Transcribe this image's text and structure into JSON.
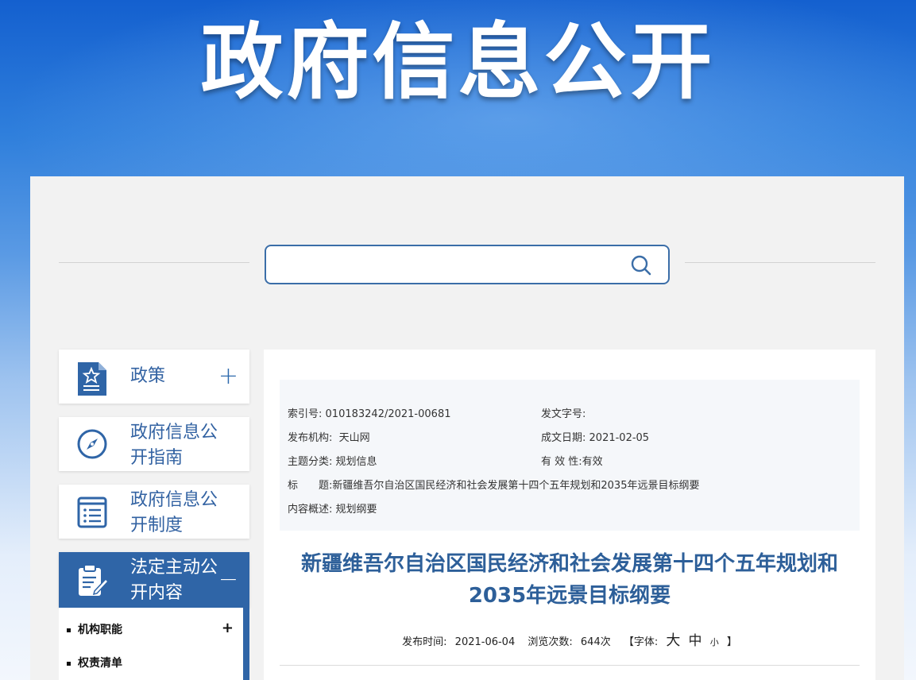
{
  "banner": {
    "title": "政府信息公开"
  },
  "search": {
    "value": "",
    "placeholder": ""
  },
  "sidebar": {
    "items": [
      {
        "label": "政策",
        "toggle": "+",
        "icon": "policy-document-icon"
      },
      {
        "label": "政府信息公开指南",
        "icon": "compass-icon"
      },
      {
        "label": "政府信息公开制度",
        "icon": "list-document-icon"
      },
      {
        "label": "法定主动公开内容",
        "toggle": "−",
        "icon": "clipboard-pen-icon"
      }
    ],
    "subitems": [
      {
        "label": "机构职能",
        "toggle": "+"
      },
      {
        "label": "权责清单"
      }
    ]
  },
  "meta": {
    "index_label": "索引号:",
    "index_value": "010183242/2021-00681",
    "docno_label": "发文字号:",
    "docno_value": "",
    "org_label": "发布机构:",
    "org_value": "天山网",
    "date_label": "成文日期:",
    "date_value": "2021-02-05",
    "topic_label": "主题分类:",
    "topic_value": "规划信息",
    "valid_label": "有 效 性:",
    "valid_value": "有效",
    "title_label": "标　　题:",
    "title_value": "新疆维吾尔自治区国民经济和社会发展第十四个五年规划和2035年远景目标纲要",
    "summary_label": "内容概述:",
    "summary_value": "规划纲要"
  },
  "article": {
    "title_line1": "新疆维吾尔自治区国民经济和社会发展第十四个五年规划和",
    "title_line2": "2035年远景目标纲要",
    "publish_label": "发布时间:",
    "publish_value": "2021-06-04",
    "views_label": "浏览次数:",
    "views_value": "644次",
    "font_label": "【字体:",
    "font_big": "大",
    "font_mid": "中",
    "font_small": "小",
    "font_close": "】"
  },
  "colors": {
    "accent": "#2f65a7",
    "title_blue": "#2d5f99",
    "banner_top": "#1460cf"
  }
}
